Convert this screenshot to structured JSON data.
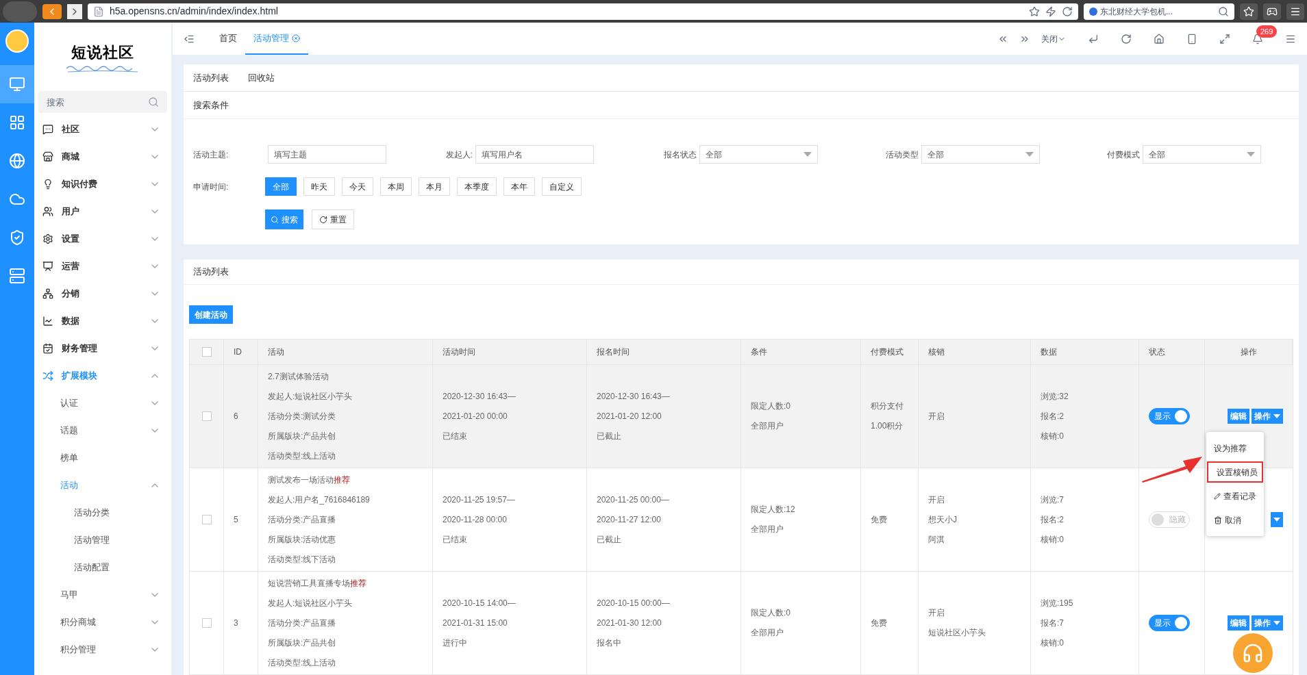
{
  "browser": {
    "url": "h5a.opensns.cn/admin/index/index.html",
    "search": "东北财经大学包机..."
  },
  "logo": {
    "title": "短说社区"
  },
  "rail": [
    {
      "kind": "monitor",
      "selected": true
    },
    {
      "kind": "grid",
      "selected": false
    },
    {
      "kind": "globe",
      "selected": false
    },
    {
      "kind": "cloud",
      "selected": false
    },
    {
      "kind": "shield",
      "selected": false
    },
    {
      "kind": "server",
      "selected": false
    }
  ],
  "sidebar": {
    "search": {
      "placeholder": "搜索"
    },
    "items": [
      {
        "kind": "community",
        "label": "社区",
        "expanded": false,
        "selected": false
      },
      {
        "kind": "shop",
        "label": "商城",
        "expanded": false,
        "selected": false
      },
      {
        "kind": "knowledge",
        "label": "知识付费",
        "expanded": false,
        "selected": false
      },
      {
        "kind": "user",
        "label": "用户",
        "expanded": false,
        "selected": false
      },
      {
        "kind": "settings",
        "label": "设置",
        "expanded": false,
        "selected": false
      },
      {
        "kind": "operation",
        "label": "运营",
        "expanded": false,
        "selected": false
      },
      {
        "kind": "distribution",
        "label": "分销",
        "expanded": false,
        "selected": false
      },
      {
        "kind": "data",
        "label": "数据",
        "expanded": false,
        "selected": false
      },
      {
        "kind": "finance",
        "label": "财务管理",
        "expanded": false,
        "selected": false
      },
      {
        "kind": "extension",
        "label": "扩展模块",
        "expanded": true,
        "selected": true,
        "children": [
          {
            "label": "认证",
            "expanded": false,
            "selected": false
          },
          {
            "label": "话题",
            "expanded": false,
            "selected": false
          },
          {
            "label": "榜单",
            "selected": false
          },
          {
            "label": "活动",
            "expanded": true,
            "selected": true,
            "children": [
              {
                "label": "活动分类",
                "selected": false
              },
              {
                "label": "活动管理",
                "selected": false
              },
              {
                "label": "活动配置",
                "selected": false
              }
            ]
          },
          {
            "label": "马甲",
            "expanded": false,
            "selected": false
          },
          {
            "label": "积分商城",
            "expanded": false,
            "selected": false
          },
          {
            "label": "积分管理",
            "expanded": false,
            "selected": false
          }
        ]
      }
    ]
  },
  "nav": {
    "tabs": [
      {
        "label": "首页",
        "selected": false,
        "closable": false
      },
      {
        "label": "活动管理",
        "selected": true,
        "closable": true
      }
    ],
    "close_menu": "关闭",
    "notifications": "269"
  },
  "page_tabs": [
    "活动列表",
    "回收站"
  ],
  "search_panel": {
    "title": "搜索条件",
    "fields": [
      {
        "kind": "input",
        "label": "活动主题:",
        "placeholder": "填写主题"
      },
      {
        "kind": "input",
        "label": "发起人:",
        "placeholder": "填写用户名"
      },
      {
        "kind": "select",
        "label": "报名状态",
        "value": "全部"
      },
      {
        "kind": "select",
        "label": "活动类型",
        "value": "全部"
      },
      {
        "kind": "select",
        "label": "付费模式",
        "value": "全部"
      }
    ],
    "time": {
      "label": "申请时间:",
      "options": [
        {
          "label": "全部",
          "selected": true
        },
        {
          "label": "昨天",
          "selected": false
        },
        {
          "label": "今天",
          "selected": false
        },
        {
          "label": "本周",
          "selected": false
        },
        {
          "label": "本月",
          "selected": false
        },
        {
          "label": "本季度",
          "selected": false
        },
        {
          "label": "本年",
          "selected": false
        },
        {
          "label": "自定义",
          "selected": false
        }
      ]
    },
    "search_button": "搜索",
    "reset_button": "重置"
  },
  "list": {
    "title": "活动列表",
    "create_button": "创建活动",
    "header_checked": false,
    "columns": [
      "ID",
      "活动",
      "活动时间",
      "报名时间",
      "条件",
      "付费模式",
      "核销",
      "数据",
      "状态",
      "操作"
    ],
    "rows": [
      {
        "hovered": true,
        "checked": false,
        "id": "6",
        "activity": {
          "title": "2.7测试体验活动",
          "details": [
            "发起人:短说社区小芋头",
            "活动分类:测试分类",
            "所属版块:产品共创",
            "活动类型:线上活动"
          ]
        },
        "time": [
          "2020-12-30 16:43—",
          "2021-01-20 00:00",
          "已结束"
        ],
        "signup": [
          "2020-12-30 16:43—",
          "2021-01-20 12:00",
          "已截止"
        ],
        "conditions": [
          "限定人数:0",
          "全部用户"
        ],
        "payment": [
          "积分支付",
          "1.00积分"
        ],
        "verify": [
          "开启"
        ],
        "data": [
          "浏览:32",
          "报名:2",
          "核销:0"
        ],
        "status": {
          "label": "显示",
          "on": true
        },
        "actions": [
          "编辑",
          "操作"
        ]
      },
      {
        "hovered": false,
        "checked": false,
        "id": "5",
        "activity": {
          "title": "测试发布一场活动",
          "tag": "推荐",
          "details": [
            "发起人:用户名_7616846189",
            "活动分类:产品直播",
            "所属版块:活动优惠",
            "活动类型:线下活动"
          ]
        },
        "time": [
          "2020-11-25 19:57—",
          "2020-11-28 00:00",
          "已结束"
        ],
        "signup": [
          "2020-11-25 00:00—",
          "2020-11-27 12:00",
          "已截止"
        ],
        "conditions": [
          "限定人数:12",
          "全部用户"
        ],
        "payment": [
          "免费"
        ],
        "verify": [
          "开启",
          "想天小J",
          "阿淇"
        ],
        "data": [
          "浏览:7",
          "报名:2",
          "核销:0"
        ],
        "status": {
          "label": "隐藏",
          "on": false
        }
      },
      {
        "hovered": false,
        "checked": false,
        "id": "3",
        "activity": {
          "title": "短说营销工具直播专场",
          "tag": "推荐",
          "details": [
            "发起人:短说社区小芋头",
            "活动分类:产品直播",
            "所属版块:产品共创",
            "活动类型:线上活动"
          ]
        },
        "time": [
          "2020-10-15 14:00—",
          "2021-01-31 15:00",
          "进行中"
        ],
        "signup": [
          "2020-10-15 00:00—",
          "2021-01-30 12:00",
          "报名中"
        ],
        "conditions": [
          "限定人数:0",
          "全部用户"
        ],
        "payment": [
          "免费"
        ],
        "verify": [
          "开启",
          "短说社区小芋头"
        ],
        "data": [
          "浏览:195",
          "报名:7",
          "核销:0"
        ],
        "status": {
          "label": "显示",
          "on": true
        },
        "actions": [
          "编辑",
          "操作"
        ]
      }
    ]
  },
  "dropdown": {
    "items": [
      {
        "kind": "plain",
        "label": "设为推荐",
        "highlighted": false
      },
      {
        "kind": "edit",
        "label": "设置核销员",
        "highlighted": true
      },
      {
        "kind": "edit",
        "label": "查看记录",
        "highlighted": false
      },
      {
        "kind": "delete",
        "label": "取消",
        "highlighted": false
      }
    ]
  }
}
